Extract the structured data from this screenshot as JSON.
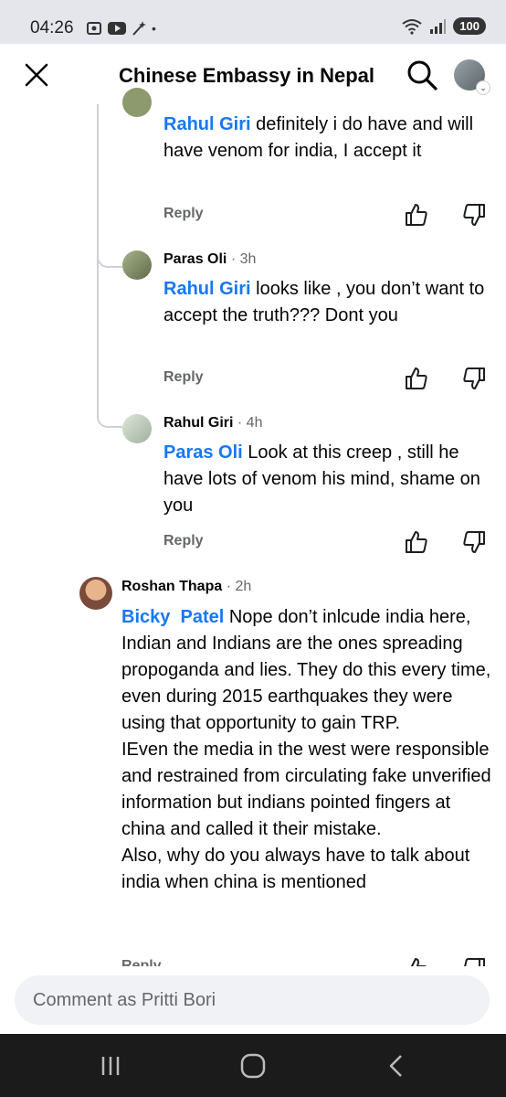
{
  "status_bar": {
    "time": "04:26",
    "dot": "•",
    "battery": "100"
  },
  "header": {
    "title": "Chinese Embassy in Nepal"
  },
  "comments": [
    {
      "mention": "Rahul Giri",
      "text": " definitely i do have and will have venom for india, I accept it",
      "reply_label": "Reply"
    },
    {
      "author": "Paras Oli",
      "time": "· 3h",
      "mention": "Rahul Giri",
      "text": " looks like , you don’t want to accept the truth??? Dont you",
      "reply_label": "Reply"
    },
    {
      "author": "Rahul Giri",
      "time": "· 4h",
      "mention": "Paras Oli",
      "text": " Look at this creep , still he have lots of venom his mind, shame on you",
      "reply_label": "Reply"
    },
    {
      "author": "Roshan Thapa",
      "time": "· 2h",
      "mention": "Bicky  Patel",
      "text": " Nope don’t inlcude india here, Indian and Indians are the ones spreading propoganda and lies. They do this every time, even during 2015 earthquakes they were using that opportunity to gain TRP.",
      "text2": "IEven the media in the west were responsible and restrained from circulating fake unverified information but indians pointed fingers at china and called it their mistake.",
      "text3": "Also, why do you always have to talk about india when china is mentioned",
      "reply_label": "Reply"
    }
  ],
  "composer": {
    "placeholder": "Comment as Pritti Bori"
  }
}
